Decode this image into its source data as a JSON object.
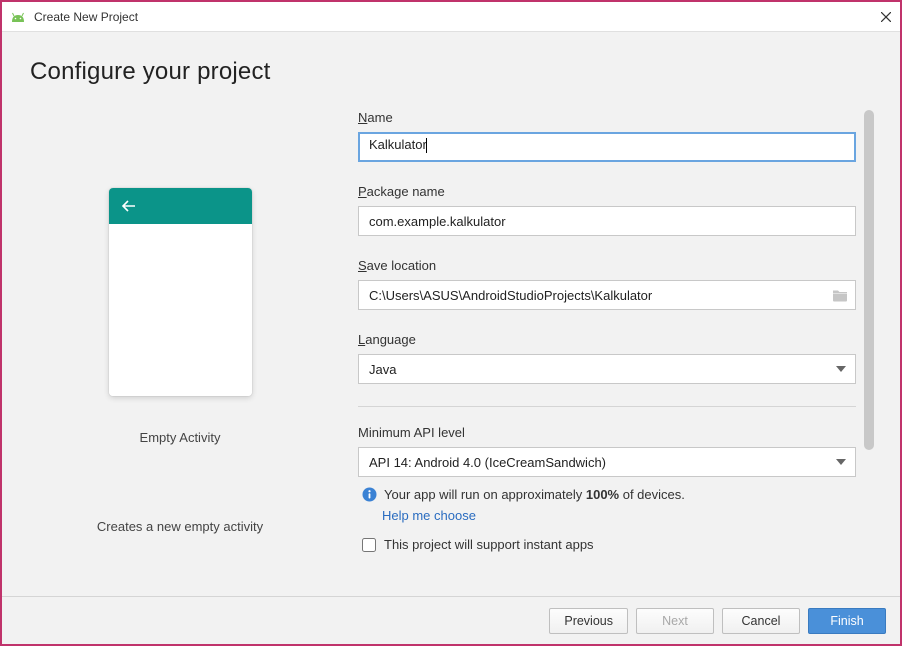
{
  "titlebar": {
    "title": "Create New Project"
  },
  "heading": "Configure your project",
  "template": {
    "name": "Empty Activity",
    "description": "Creates a new empty activity"
  },
  "form": {
    "name": {
      "label": "Name",
      "value": "Kalkulator"
    },
    "package": {
      "label": "Package name",
      "value": "com.example.kalkulator"
    },
    "location": {
      "label": "Save location",
      "value": "C:\\Users\\ASUS\\AndroidStudioProjects\\Kalkulator"
    },
    "language": {
      "label": "Language",
      "value": "Java"
    },
    "api": {
      "label": "Minimum API level",
      "value": "API 14: Android 4.0 (IceCreamSandwich)",
      "info_prefix": "Your app will run on approximately ",
      "info_percent": "100%",
      "info_suffix": " of devices.",
      "help": "Help me choose"
    },
    "instant": {
      "label": "This project will support instant apps"
    }
  },
  "buttons": {
    "previous": "Previous",
    "next": "Next",
    "cancel": "Cancel",
    "finish": "Finish"
  }
}
